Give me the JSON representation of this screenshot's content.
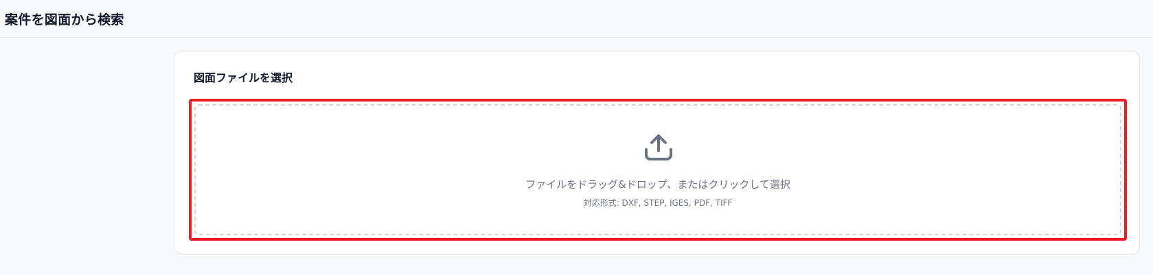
{
  "header": {
    "title": "案件を図面から検索"
  },
  "upload_card": {
    "title": "図面ファイルを選択",
    "dropzone": {
      "icon": "upload-icon",
      "instruction": "ファイルをドラッグ&ドロップ、またはクリックして選択",
      "supported_formats": "対応形式: DXF, STEP, IGES, PDF, TIFF"
    }
  },
  "colors": {
    "highlight_border": "#ee1c24",
    "icon": "#6b7280",
    "text_muted": "#6b7280",
    "background": "#f9fafb"
  }
}
